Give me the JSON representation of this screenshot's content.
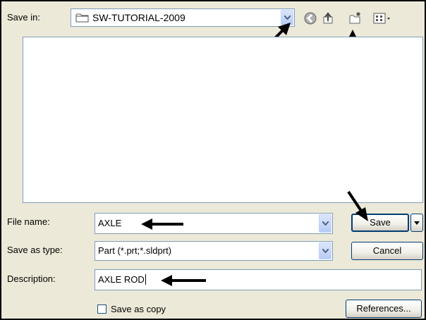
{
  "save_in": {
    "label": "Save in:",
    "folder_name": "SW-TUTORIAL-2009"
  },
  "toolbar": {
    "icons": [
      "back-icon",
      "up-folder-icon",
      "new-folder-icon",
      "views-menu-icon"
    ]
  },
  "file_name": {
    "label": "File name:",
    "value": "AXLE"
  },
  "save_as_type": {
    "label": "Save as type:",
    "value": "Part (*.prt;*.sldprt)"
  },
  "description": {
    "label": "Description:",
    "value": "AXLE ROD"
  },
  "buttons": {
    "save": "Save",
    "cancel": "Cancel",
    "references": "References..."
  },
  "save_as_copy": {
    "label": "Save as copy",
    "checked": false
  },
  "colors": {
    "dialog_bg": "#ece9d8",
    "field_border": "#7f9db9",
    "folder_yellow": "#f5d97a"
  }
}
